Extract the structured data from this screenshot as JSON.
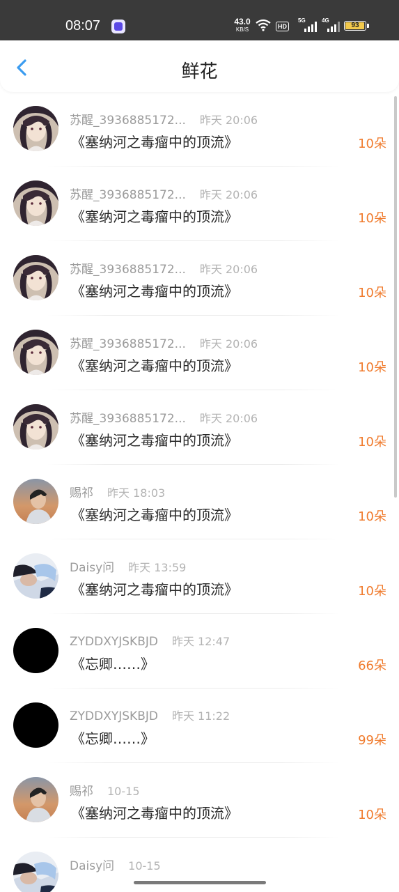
{
  "status_bar": {
    "time": "08:07",
    "net_speed": "43.0",
    "net_speed_unit": "KB/S",
    "hd_label": "HD",
    "net1": "5G",
    "net2": "4G",
    "battery": "93"
  },
  "header": {
    "title": "鲜花",
    "back_icon": "chevron-left-icon"
  },
  "colors": {
    "accent": "#f07b2d",
    "back_arrow": "#3b9cf0",
    "status_bar_bg": "#3a3a3a"
  },
  "records": [
    {
      "name": "苏醒_3936885172...",
      "time": "昨天 20:06",
      "book": "《塞纳河之毒瘤中的顶流》",
      "amount": "10朵",
      "avatar": "anime"
    },
    {
      "name": "苏醒_3936885172...",
      "time": "昨天 20:06",
      "book": "《塞纳河之毒瘤中的顶流》",
      "amount": "10朵",
      "avatar": "anime"
    },
    {
      "name": "苏醒_3936885172...",
      "time": "昨天 20:06",
      "book": "《塞纳河之毒瘤中的顶流》",
      "amount": "10朵",
      "avatar": "anime"
    },
    {
      "name": "苏醒_3936885172...",
      "time": "昨天 20:06",
      "book": "《塞纳河之毒瘤中的顶流》",
      "amount": "10朵",
      "avatar": "anime"
    },
    {
      "name": "苏醒_3936885172...",
      "time": "昨天 20:06",
      "book": "《塞纳河之毒瘤中的顶流》",
      "amount": "10朵",
      "avatar": "anime"
    },
    {
      "name": "赐祁",
      "time": "昨天 18:03",
      "book": "《塞纳河之毒瘤中的顶流》",
      "amount": "10朵",
      "avatar": "sunset"
    },
    {
      "name": "Daisy问",
      "time": "昨天 13:59",
      "book": "《塞纳河之毒瘤中的顶流》",
      "amount": "10朵",
      "avatar": "daisy"
    },
    {
      "name": "ZYDDXYJSKBJD",
      "time": "昨天 12:47",
      "book": "《忘卿……》",
      "amount": "66朵",
      "avatar": "black"
    },
    {
      "name": "ZYDDXYJSKBJD",
      "time": "昨天 11:22",
      "book": "《忘卿……》",
      "amount": "99朵",
      "avatar": "black"
    },
    {
      "name": "赐祁",
      "time": "10-15",
      "book": "《塞纳河之毒瘤中的顶流》",
      "amount": "10朵",
      "avatar": "sunset"
    },
    {
      "name": "Daisy问",
      "time": "10-15",
      "book": "",
      "amount": "",
      "avatar": "daisy"
    }
  ]
}
